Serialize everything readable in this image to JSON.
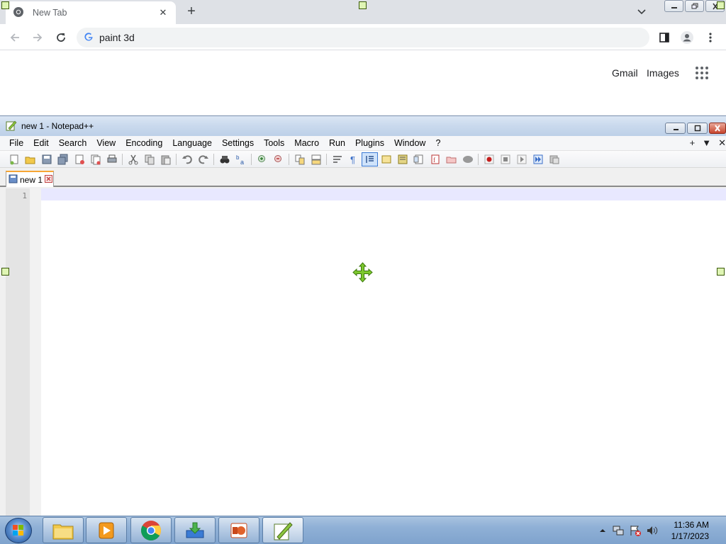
{
  "chrome": {
    "tab_title": "New Tab",
    "tab_close": "✕",
    "new_tab": "+",
    "omnibox_text": "paint 3d",
    "gmail": "Gmail",
    "images": "Images"
  },
  "notepad": {
    "title": "new 1 - Notepad++",
    "menu": [
      "File",
      "Edit",
      "Search",
      "View",
      "Encoding",
      "Language",
      "Settings",
      "Tools",
      "Macro",
      "Run",
      "Plugins",
      "Window",
      "?"
    ],
    "menu_right": [
      "+",
      "▼",
      "✕"
    ],
    "tab_label": "new 1",
    "line_number": "1"
  },
  "taskbar": {
    "time": "11:36 AM",
    "date": "1/17/2023"
  },
  "colors": {
    "chrome_tabbar": "#dee1e6",
    "npp_title": "#c9d9ed",
    "tab_accent": "#f7a634",
    "handle_fill": "#dff5b4",
    "move_cursor": "#7dc82d"
  }
}
